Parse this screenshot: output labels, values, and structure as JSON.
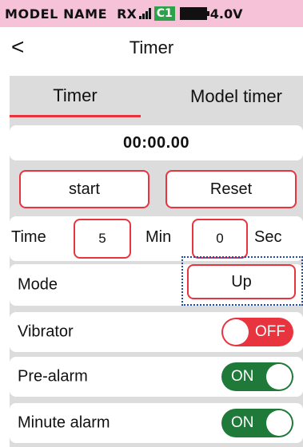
{
  "status": {
    "model_name": "MODEL NAME",
    "rx_label": "RX",
    "channel": "C1",
    "voltage": "4.0V"
  },
  "header": {
    "back_symbol": "<",
    "title": "Timer"
  },
  "tabs": [
    {
      "label": "Timer",
      "active": true
    },
    {
      "label": "Model timer",
      "active": false
    }
  ],
  "timer": {
    "display": "00:00.00",
    "start_label": "start",
    "reset_label": "Reset"
  },
  "time_setting": {
    "label": "Time",
    "minutes": "5",
    "min_unit": "Min",
    "seconds": "0",
    "sec_unit": "Sec"
  },
  "mode": {
    "label": "Mode",
    "value": "Up"
  },
  "settings": [
    {
      "label": "Vibrator",
      "state": "OFF"
    },
    {
      "label": "Pre-alarm",
      "state": "ON"
    },
    {
      "label": "Minute alarm",
      "state": "ON"
    }
  ],
  "colors": {
    "status_bg": "#f6c2d8",
    "accent_red": "#e8343f",
    "toggle_on": "#1f7a3a",
    "panel_bg": "#dcdcdc",
    "focus_outline": "#1f4fa8",
    "channel_badge": "#2ea24a"
  },
  "icons": {
    "signal": "signal-bars-icon",
    "battery": "battery-icon",
    "back": "chevron-left-icon"
  }
}
